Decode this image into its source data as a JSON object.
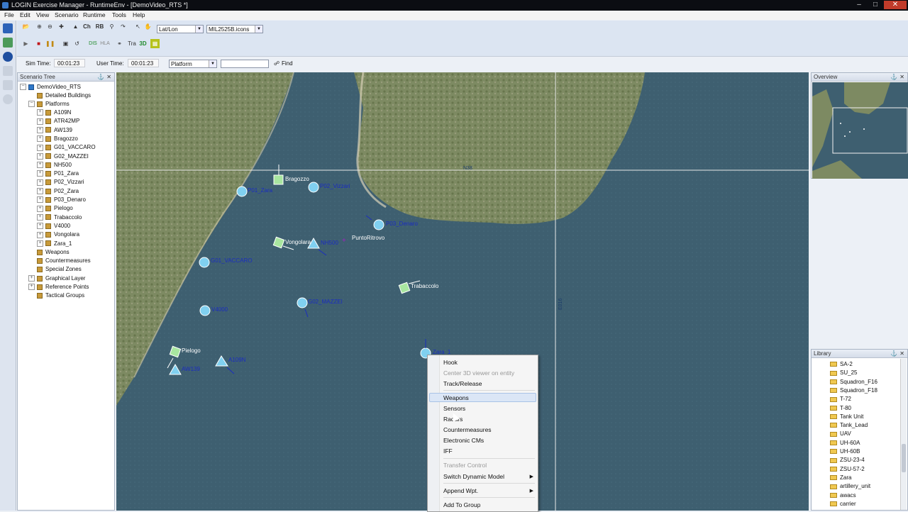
{
  "window": {
    "title": "LOGIN Exercise Manager - RuntimeEnv - [DemoVideo_RTS *]"
  },
  "menu": [
    "File",
    "Edit",
    "View",
    "Scenario",
    "Runtime",
    "Tools",
    "Help"
  ],
  "toolbar": {
    "coord_system": "Lat/Lon",
    "icon_set": "MIL2525B.icons",
    "labels": {
      "ch": "Ch",
      "rb": "RB",
      "dis": "DIS",
      "hla": "HLA",
      "tra": "Tra",
      "three_d": "3D"
    }
  },
  "status": {
    "sim_time_label": "Sim Time:",
    "sim_time": "00:01:23",
    "user_time_label": "User Time:",
    "user_time": "00:01:23",
    "filter": "Platform",
    "search_value": "",
    "find_label": "Find"
  },
  "scenario_tree": {
    "title": "Scenario Tree",
    "root": "DemoVideo_RTS",
    "detailed_buildings": "Detailed Buildings",
    "platforms_label": "Platforms",
    "platforms": [
      "A109N",
      "ATR42MP",
      "AW139",
      "Bragozzo",
      "G01_VACCARO",
      "G02_MAZZEI",
      "NH500",
      "P01_Zara",
      "P02_Vizzari",
      "P02_Zara",
      "P03_Denaro",
      "Pielogo",
      "Trabaccolo",
      "V4000",
      "Vongolara",
      "Zara_1"
    ],
    "others": [
      "Weapons",
      "Countermeasures",
      "Special Zones",
      "Graphical Layer",
      "Reference Points",
      "Tactical Groups"
    ]
  },
  "map": {
    "grid_labels": {
      "lat": "N38",
      "lon": "E016"
    },
    "entities": [
      {
        "label": "Bragozzo",
        "kind": "neutral"
      },
      {
        "label": "P02_Vizzari",
        "kind": "friend"
      },
      {
        "label": "P01_Zara",
        "kind": "friend"
      },
      {
        "label": "P03_Denaro",
        "kind": "friend"
      },
      {
        "label": "PuntoRitrovo",
        "kind": "point"
      },
      {
        "label": "Vongolara",
        "kind": "neutral"
      },
      {
        "label": "NH500",
        "kind": "friend-air"
      },
      {
        "label": "G01_VACCARO",
        "kind": "friend"
      },
      {
        "label": "Trabaccolo",
        "kind": "neutral"
      },
      {
        "label": "G02_MAZZEI",
        "kind": "friend"
      },
      {
        "label": "V4000",
        "kind": "friend"
      },
      {
        "label": "Pielogo",
        "kind": "neutral"
      },
      {
        "label": "A109N",
        "kind": "friend-air"
      },
      {
        "label": "AW139",
        "kind": "friend-air"
      },
      {
        "label": "Zara_1",
        "kind": "friend"
      }
    ]
  },
  "overview": {
    "title": "Overview"
  },
  "library": {
    "title": "Library",
    "items": [
      "SA-2",
      "SU_25",
      "Squadron_F16",
      "Squadron_F18",
      "T-72",
      "T-80",
      "Tank Unit",
      "Tank_Lead",
      "UAV",
      "UH-60A",
      "UH-60B",
      "ZSU-23-4",
      "ZSU-57-2",
      "Zara",
      "artillery_unit",
      "awacs",
      "carrier"
    ]
  },
  "context_menu": {
    "hook": "Hook",
    "center_3d": "Center 3D viewer on entity",
    "track_release": "Track/Release",
    "weapons": "Weapons",
    "sensors": "Sensors",
    "radars": "Radars",
    "countermeasures": "Countermeasures",
    "electronic_cms": "Electronic CMs",
    "iff": "IFF",
    "transfer_control": "Transfer Control",
    "switch_dynamic_model": "Switch Dynamic Model",
    "append_wpt": "Append Wpt.",
    "add_to_group": "Add To Group"
  },
  "colors": {
    "sea": "#3c5d6e",
    "land": "#7f8a62",
    "friend": "#80d0f0",
    "neutral": "#a8e6a0",
    "highlight": "#dbe6f6"
  }
}
